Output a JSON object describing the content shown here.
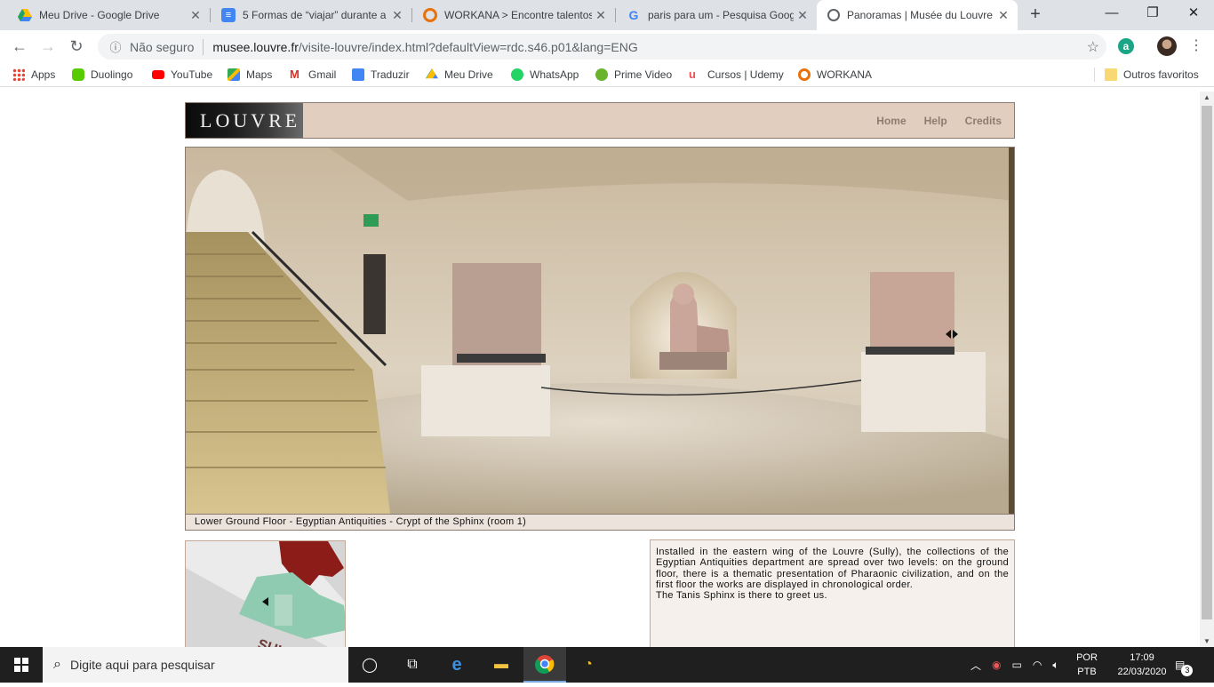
{
  "browser": {
    "tabs": [
      {
        "title": "Meu Drive - Google Drive",
        "favicon": "google-drive-icon",
        "color": "#1fa463"
      },
      {
        "title": "5 Formas de “viajar” durante a",
        "favicon": "google-docs-icon",
        "color": "#4285f4"
      },
      {
        "title": "WORKANA > Encontre talentos",
        "favicon": "workana-icon",
        "color": "#e8710a"
      },
      {
        "title": "paris para um - Pesquisa Goog",
        "favicon": "google-icon",
        "color": "#4285f4"
      },
      {
        "title": "Panoramas | Musée du Louvre",
        "favicon": "globe-icon",
        "color": "#5f6368"
      }
    ],
    "new_tab": "+",
    "window_controls": {
      "minimize": "—",
      "restore": "❐",
      "close": "✕"
    },
    "nav": {
      "back": "←",
      "forward": "→",
      "reload": "↻"
    },
    "address": {
      "security_label": "Não seguro",
      "host": "musee.louvre.fr",
      "path": "/visite-louvre/index.html?defaultView=rdc.s46.p01&lang=ENG"
    },
    "bookmarks": [
      {
        "label": "Apps",
        "icon": "apps-grid-icon",
        "color": "#ea4335"
      },
      {
        "label": "Duolingo",
        "icon": "duolingo-icon",
        "color": "#58cc02"
      },
      {
        "label": "YouTube",
        "icon": "youtube-icon",
        "color": "#ff0000"
      },
      {
        "label": "Maps",
        "icon": "maps-icon",
        "color": "#34a853"
      },
      {
        "label": "Gmail",
        "icon": "gmail-icon",
        "color": "#d93025"
      },
      {
        "label": "Traduzir",
        "icon": "translate-icon",
        "color": "#4285f4"
      },
      {
        "label": "Meu Drive",
        "icon": "google-drive-icon",
        "color": "#fbbc04"
      },
      {
        "label": "WhatsApp",
        "icon": "whatsapp-icon",
        "color": "#25d366"
      },
      {
        "label": "Prime Video",
        "icon": "prime-video-icon",
        "color": "#6ab42d"
      },
      {
        "label": "Cursos | Udemy",
        "icon": "udemy-icon",
        "color": "#ec5252"
      },
      {
        "label": "WORKANA",
        "icon": "workana-icon",
        "color": "#e8710a"
      }
    ],
    "other_bookmarks": "Outros favoritos"
  },
  "page": {
    "logo_text": "LOUVRE",
    "nav": {
      "home": "Home",
      "help": "Help",
      "credits": "Credits"
    },
    "caption": "Lower Ground Floor - Egyptian Antiquities - Crypt of the Sphinx (room 1)",
    "description": "Installed in the eastern wing of the Louvre (Sully), the collections of the Egyptian Antiquities department are spread over two levels: on the ground floor, there is a thematic presentation of Pharaonic civilization, and on the first floor the works are displayed in chronological order.",
    "description_2": "The Tanis Sphinx is there to greet us.",
    "map_label": "SULLY"
  },
  "taskbar": {
    "search_placeholder": "Digite aqui para pesquisar",
    "lang_top": "POR",
    "lang_bottom": "PTB",
    "time": "17:09",
    "date": "22/03/2020",
    "notifications": "3"
  },
  "colors": {
    "header_bg": "#e2cebf",
    "nav_text": "#8f7b6f",
    "caption_bg": "#ece3dc",
    "desc_bg": "#f5f0ec",
    "map_red": "#8b1c18",
    "map_green": "#8fcbb0"
  }
}
